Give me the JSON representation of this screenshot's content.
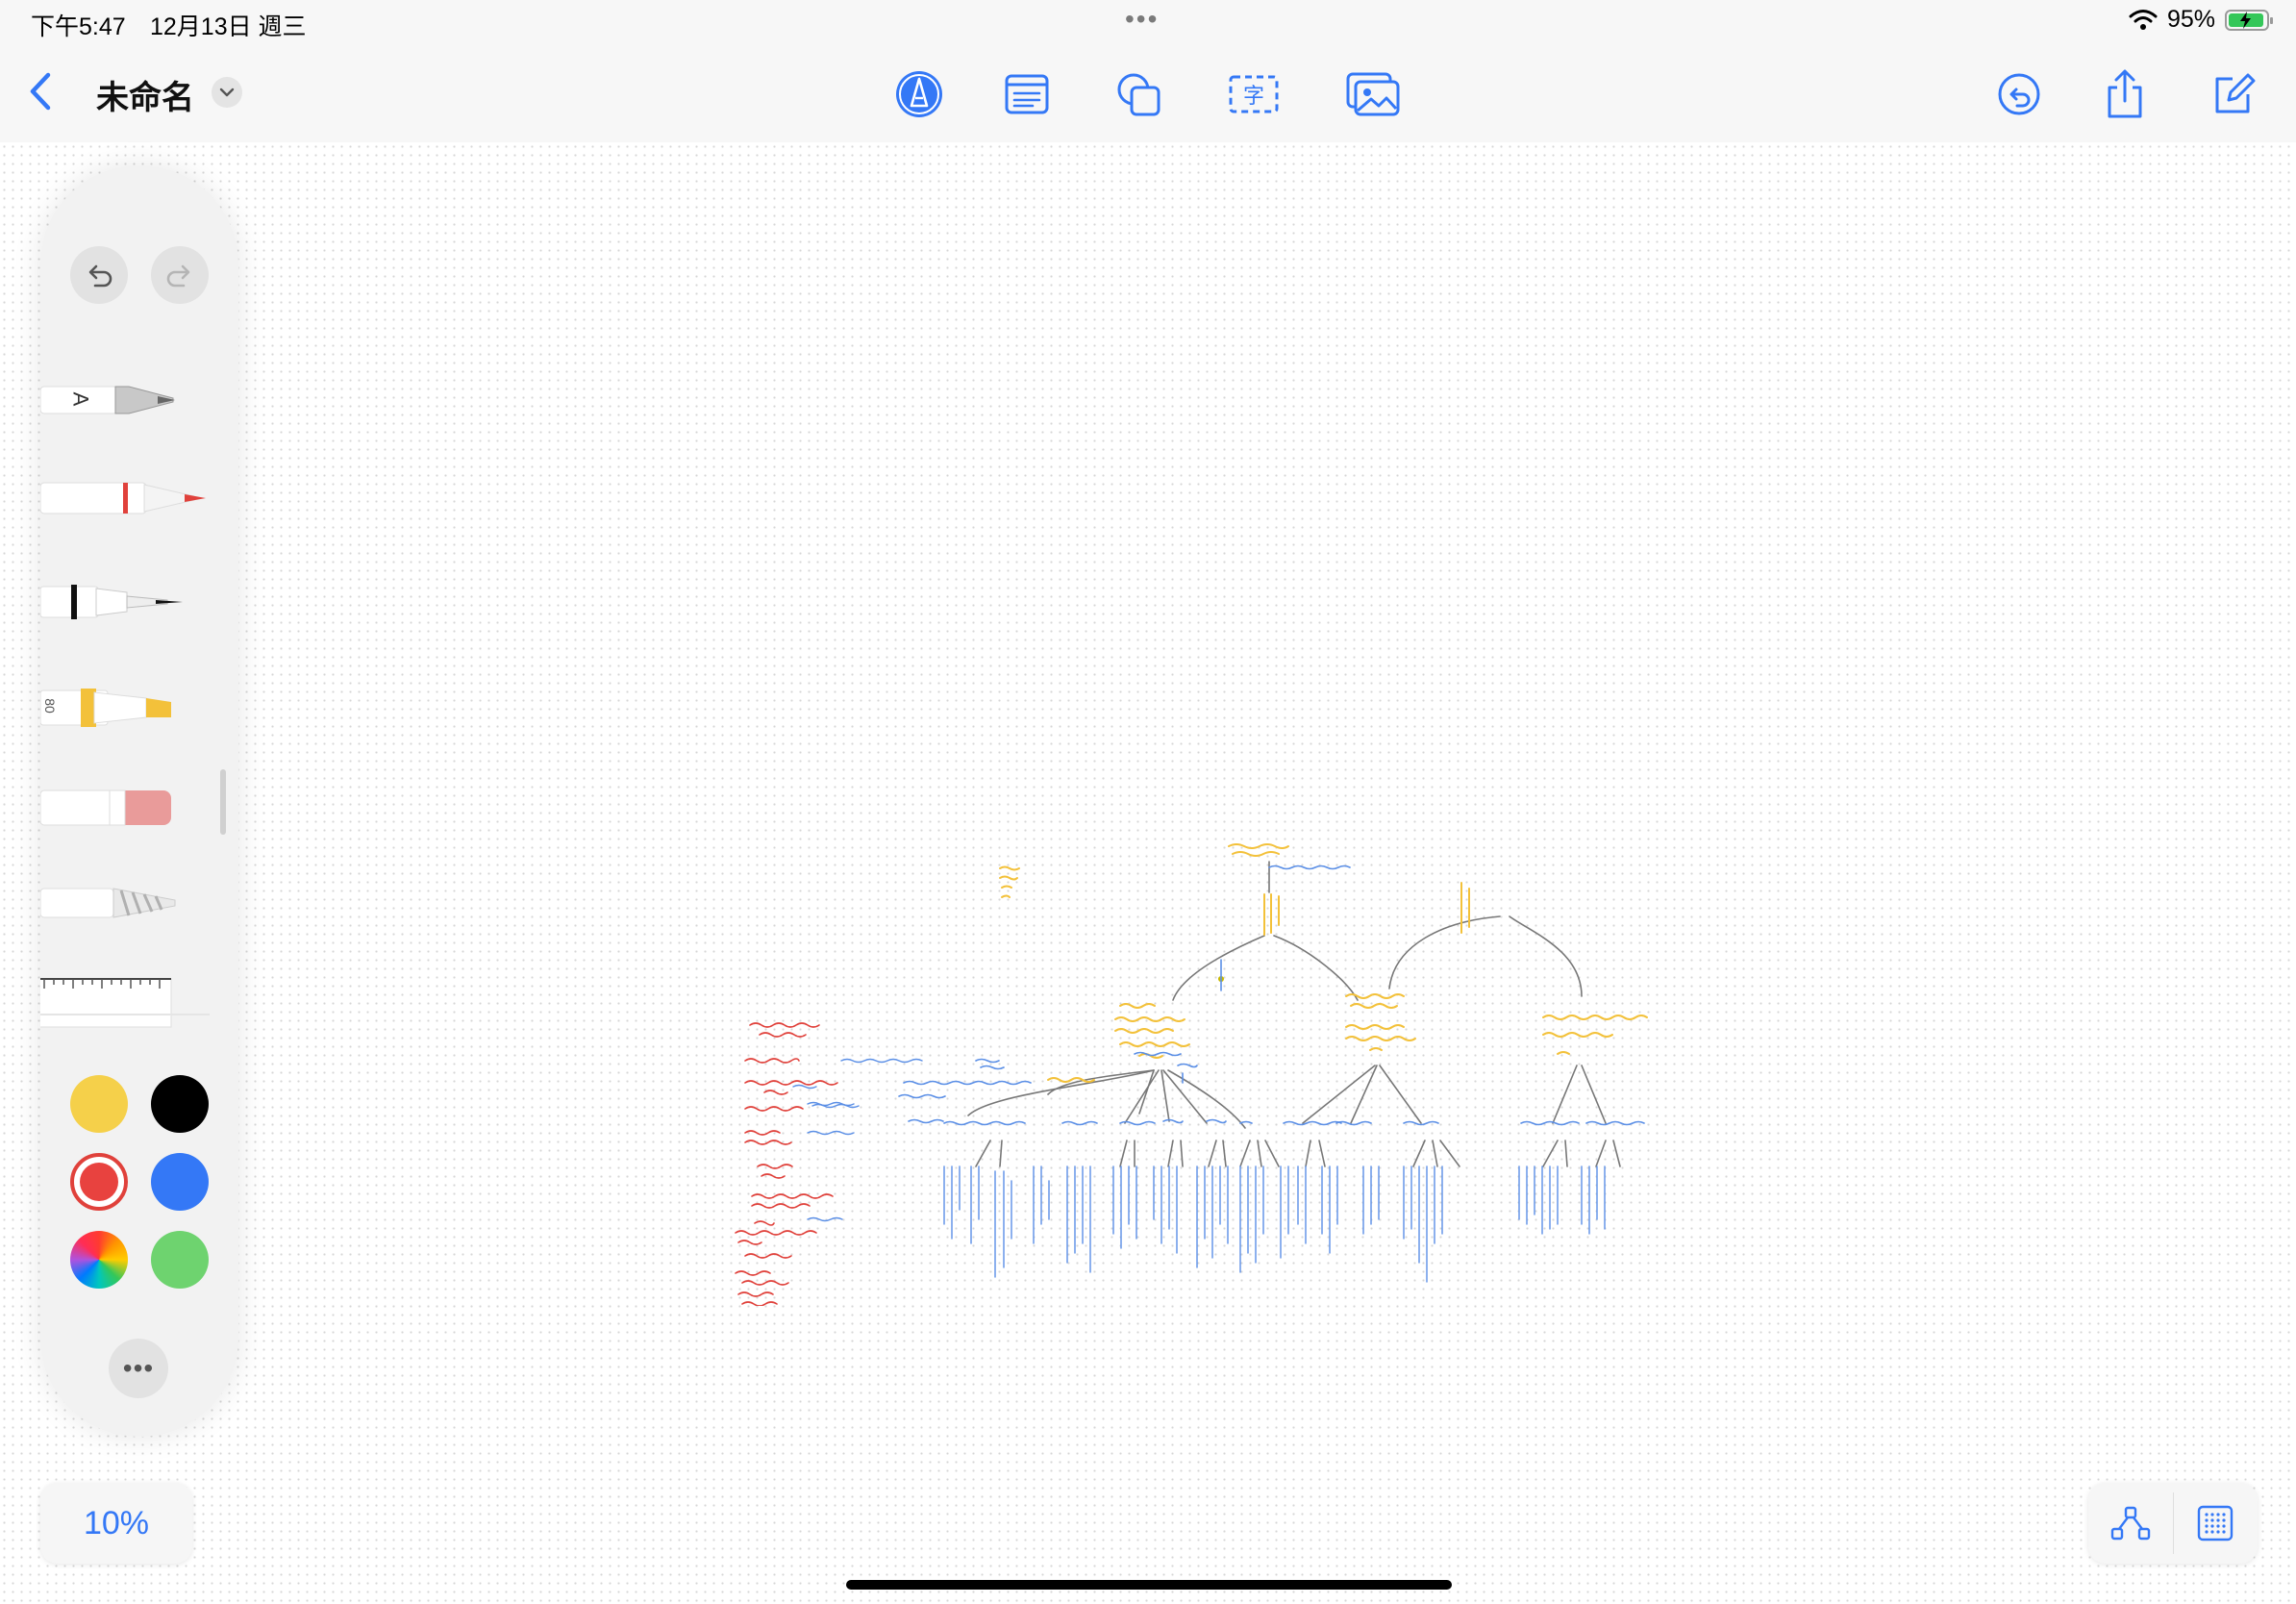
{
  "status": {
    "time": "下午5:47",
    "date": "12月13日 週三",
    "battery": "95%",
    "battery_level": 0.95,
    "icons": [
      "wifi-icon",
      "battery-charging-icon"
    ]
  },
  "toolbar": {
    "title": "未命名",
    "tools": [
      "pen-tool-icon",
      "note-icon",
      "shapes-icon",
      "text-box-icon",
      "image-icon"
    ],
    "right_tools": [
      "undo-history-icon",
      "share-icon",
      "compose-icon"
    ]
  },
  "palette": {
    "tools": [
      "text-pen",
      "marker",
      "fineliner",
      "highlighter",
      "eraser",
      "pencil",
      "ruler"
    ],
    "highlighter_label": "80",
    "pen_label": "A",
    "colors": [
      "#f5d04a",
      "#000000",
      "#e8423f",
      "#3478f6",
      "multicolor",
      "#6ed36f"
    ],
    "selected_color": "#e8423f"
  },
  "zoom": {
    "label": "10%"
  },
  "colors": {
    "accent": "#3478f6",
    "yellow_ink": "#f3c13a",
    "blue_ink": "#5b8fe6",
    "red_ink": "#e0413b",
    "gray_ink": "#707070"
  }
}
